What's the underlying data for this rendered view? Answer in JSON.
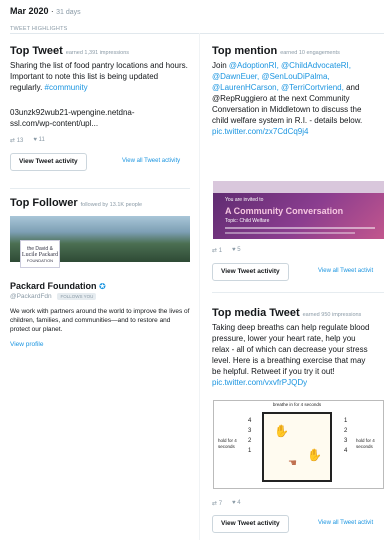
{
  "header": {
    "month": "Mar 2020",
    "sep": " · ",
    "days": "31 days"
  },
  "highlights_label": "TWEET HIGHLIGHTS",
  "top_tweet": {
    "title": "Top Tweet",
    "sub": "earned 1,391 impressions",
    "text": "Sharing the list of food pantry locations and hours.  Important to note this list is being updated regularly.",
    "hashtag": "#community",
    "link1": "03unzk92wub21-wpengine.netdna-",
    "link2": "ssl.com/wp-content/upl...",
    "retweets": "13",
    "likes": "11",
    "button": "View Tweet activity",
    "view_all": "View all Tweet activity"
  },
  "top_follower": {
    "title": "Top Follower",
    "sub": "followed by 13.1K people",
    "logo_line1": "the David &",
    "logo_line2": "Lucile Packard",
    "logo_line3": "FOUNDATION",
    "name": "Packard Foundation",
    "handle": "@PackardFdn",
    "follows_badge": "FOLLOWS YOU",
    "bio": "We work with partners around the world to improve the lives of children, families, and communities—and to restore and protect our planet.",
    "view_profile": "View profile"
  },
  "top_mention": {
    "title": "Top mention",
    "sub": "earned 10 engagements",
    "line1a": "Join ",
    "line1b": "@AdoptionRI, @ChildAdvocateRI,",
    "line2": "@DawnEuer, @SenLouDiPalma,",
    "line3": "@LaurenHCarson, @TerriCortvriend,",
    "line3b": " and",
    "line4": "@RepRuggiero at the next Community",
    "line5": "Conversation in Middletown to discuss the",
    "line6": "child welfare system in R.I. - details below.",
    "link": "pic.twitter.com/zx7CdCq9j4",
    "promo_small": "You are invited to",
    "promo_title": "A Community Conversation",
    "promo_topic": "Topic: Child Welfare",
    "retweets": "1",
    "likes": "5",
    "button": "View Tweet activity",
    "view_all": "View all Tweet activit"
  },
  "top_media": {
    "title": "Top media Tweet",
    "sub": "earned 950 impressions",
    "line1": "Taking deep breaths can help regulate blood",
    "line2": "pressure, lower your heart rate, help you",
    "line3": "relax - all of which can decrease your stress",
    "line4": "level.  Here is a breathing exercise that may",
    "line5": "be helpful. Retweet if you try it out!",
    "link": "pic.twitter.com/vxvfrPJQDy",
    "illus_top": "breathe in for 4 seconds",
    "illus_left": "hold for 4 seconds",
    "illus_right": "hold for 4 seconds",
    "count": [
      "1",
      "2",
      "3",
      "4"
    ],
    "retweets": "7",
    "likes": "4",
    "button": "View Tweet activity",
    "view_all": "View all Tweet activit"
  },
  "colors": {
    "link": "#1b95e0",
    "text": "#14171a",
    "muted": "#8a9aa6"
  }
}
